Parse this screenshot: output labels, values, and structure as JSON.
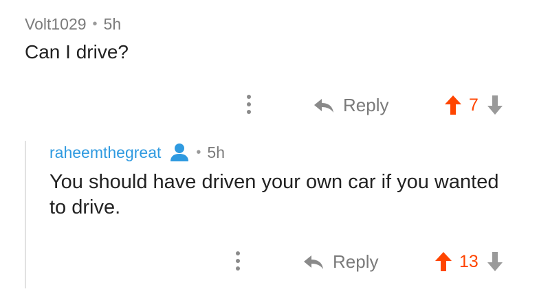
{
  "parent_comment": {
    "author": "Volt1029",
    "separator": "•",
    "time": "5h",
    "body": "Can I drive?",
    "actions": {
      "reply_label": "Reply",
      "score": "7"
    }
  },
  "reply_comment": {
    "author": "raheemthegreat",
    "separator": "•",
    "time": "5h",
    "body": "You should have driven your own car if you wanted to drive.",
    "actions": {
      "reply_label": "Reply",
      "score": "13"
    }
  },
  "colors": {
    "upvote": "#ff4500",
    "score": "#ff4500",
    "author_link": "#2f9ae0",
    "muted": "#7c7c7c",
    "downvote": "#9a9a9a"
  },
  "icons": [
    "more-options-icon",
    "reply-arrow-icon",
    "upvote-arrow-icon",
    "downvote-arrow-icon",
    "user-profile-icon"
  ]
}
